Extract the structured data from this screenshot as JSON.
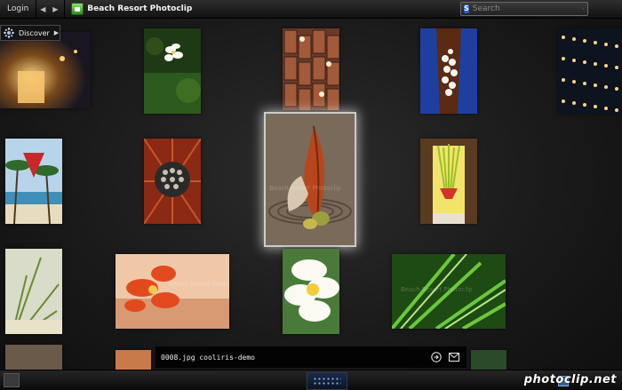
{
  "topbar": {
    "login_label": "Login",
    "app_title": "Beach Resort Photoclip",
    "search_placeholder": "Search"
  },
  "discover": {
    "label": "Discover"
  },
  "watermark": "Beach Resort Photoclip",
  "caption": {
    "text": "0008.jpg  cooliris-demo"
  },
  "footer": {
    "brand": "photoclip.net"
  },
  "colors": {
    "accent": "#3aa12a",
    "selection_glow": "#ffffff",
    "background": "#1a1a1a"
  },
  "tiles": [
    {
      "name": "tile-candle"
    },
    {
      "name": "tile-frangipani-shrub"
    },
    {
      "name": "tile-brick-path"
    },
    {
      "name": "tile-flower-boat"
    },
    {
      "name": "tile-candle-grid"
    },
    {
      "name": "tile-beach-lantern"
    },
    {
      "name": "tile-bead-ball"
    },
    {
      "name": "tile-leaf-pod",
      "selected": true
    },
    {
      "name": "tile-heliconia-vase"
    },
    {
      "name": "tile-palm-frond"
    },
    {
      "name": "tile-orange-orchid"
    },
    {
      "name": "tile-white-plumeria"
    },
    {
      "name": "tile-green-leaves"
    }
  ]
}
